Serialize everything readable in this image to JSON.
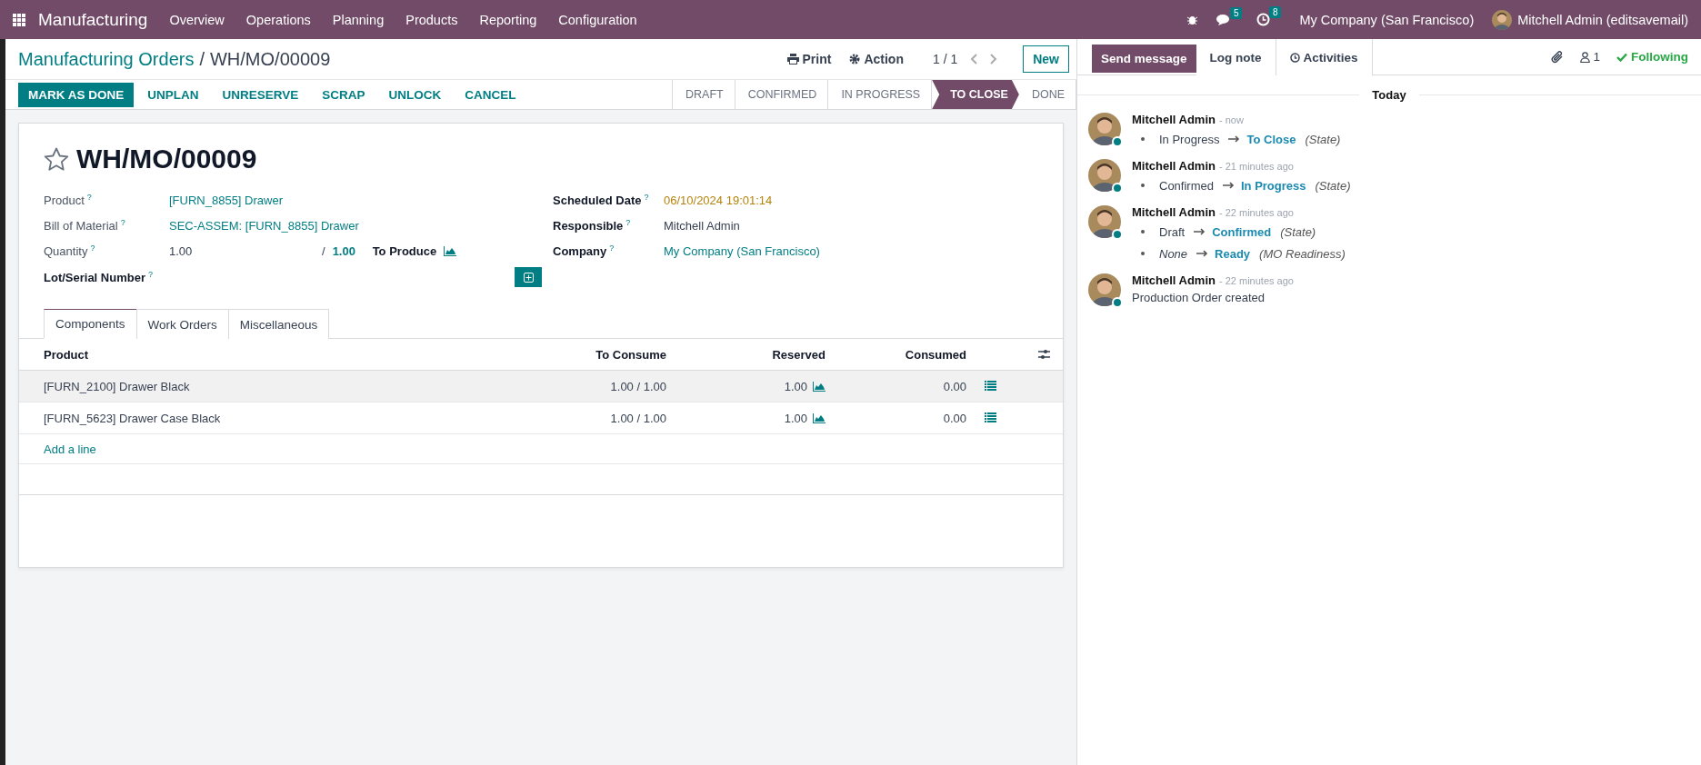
{
  "navbar": {
    "app": "Manufacturing",
    "menu": [
      "Overview",
      "Operations",
      "Planning",
      "Products",
      "Reporting",
      "Configuration"
    ],
    "messages_count": "5",
    "activities_count": "8",
    "company": "My Company (San Francisco)",
    "user": "Mitchell Admin (editsavemail)"
  },
  "breadcrumb": {
    "parent": "Manufacturing Orders",
    "separator": "/",
    "current": "WH/MO/00009"
  },
  "toolbar": {
    "print": "Print",
    "action": "Action",
    "pager": "1 / 1",
    "new": "New"
  },
  "actions": [
    {
      "label": "MARK AS DONE",
      "primary": true
    },
    {
      "label": "UNPLAN",
      "primary": false
    },
    {
      "label": "UNRESERVE",
      "primary": false
    },
    {
      "label": "SCRAP",
      "primary": false
    },
    {
      "label": "UNLOCK",
      "primary": false
    },
    {
      "label": "CANCEL",
      "primary": false
    }
  ],
  "stages": [
    {
      "label": "DRAFT",
      "selected": false
    },
    {
      "label": "CONFIRMED",
      "selected": false
    },
    {
      "label": "IN PROGRESS",
      "selected": false
    },
    {
      "label": "TO CLOSE",
      "selected": true
    },
    {
      "label": "DONE",
      "selected": false
    }
  ],
  "record": {
    "name": "WH/MO/00009",
    "starred": false
  },
  "left_fields": [
    {
      "kind": "link",
      "label": "Product",
      "help": "?",
      "value": "[FURN_8855] Drawer"
    },
    {
      "kind": "link",
      "label": "Bill of Material",
      "help": "?",
      "value": "SEC-ASSEM: [FURN_8855] Drawer"
    },
    {
      "kind": "quantity",
      "label": "Quantity",
      "help": "?",
      "value": "1.00",
      "separator": "/",
      "total": "1.00",
      "unit_label": "To Produce"
    },
    {
      "kind": "lot",
      "label": "Lot/Serial Number",
      "help": "?"
    }
  ],
  "right_fields": [
    {
      "kind": "date",
      "label": "Scheduled Date",
      "help": "?",
      "value": "06/10/2024 19:01:14"
    },
    {
      "kind": "text",
      "label": "Responsible",
      "help": "?",
      "value": "Mitchell Admin"
    },
    {
      "kind": "link",
      "label": "Company",
      "help": "?",
      "value": "My Company (San Francisco)"
    }
  ],
  "tabs": [
    {
      "label": "Components",
      "selected": true
    },
    {
      "label": "Work Orders",
      "selected": false
    },
    {
      "label": "Miscellaneous",
      "selected": false
    }
  ],
  "table": {
    "columns": [
      "Product",
      "To Consume",
      "Reserved",
      "Consumed"
    ],
    "rows": [
      {
        "product": "[FURN_2100] Drawer Black",
        "to_consume": "1.00 / 1.00",
        "reserved": "1.00",
        "consumed": "0.00",
        "selected": true
      },
      {
        "product": "[FURN_5623] Drawer Case Black",
        "to_consume": "1.00 / 1.00",
        "reserved": "1.00",
        "consumed": "0.00",
        "selected": false
      }
    ],
    "add_line": "Add a line"
  },
  "chatter": {
    "send_message": "Send message",
    "log_note": "Log note",
    "activities": "Activities",
    "followers": "1",
    "following": "Following",
    "day": "Today",
    "messages": [
      {
        "author": "Mitchell Admin",
        "time": "- now",
        "changes": [
          {
            "old": "In Progress",
            "old_empty": false,
            "new": "To Close",
            "field": "(State)"
          }
        ]
      },
      {
        "author": "Mitchell Admin",
        "time": "- 21 minutes ago",
        "changes": [
          {
            "old": "Confirmed",
            "old_empty": false,
            "new": "In Progress",
            "field": "(State)"
          }
        ]
      },
      {
        "author": "Mitchell Admin",
        "time": "- 22 minutes ago",
        "changes": [
          {
            "old": "Draft",
            "old_empty": false,
            "new": "Confirmed",
            "field": "(State)"
          },
          {
            "old": "None",
            "old_empty": true,
            "new": "Ready",
            "field": "(MO Readiness)"
          }
        ]
      },
      {
        "author": "Mitchell Admin",
        "time": "- 22 minutes ago",
        "body": "Production Order created"
      }
    ]
  }
}
